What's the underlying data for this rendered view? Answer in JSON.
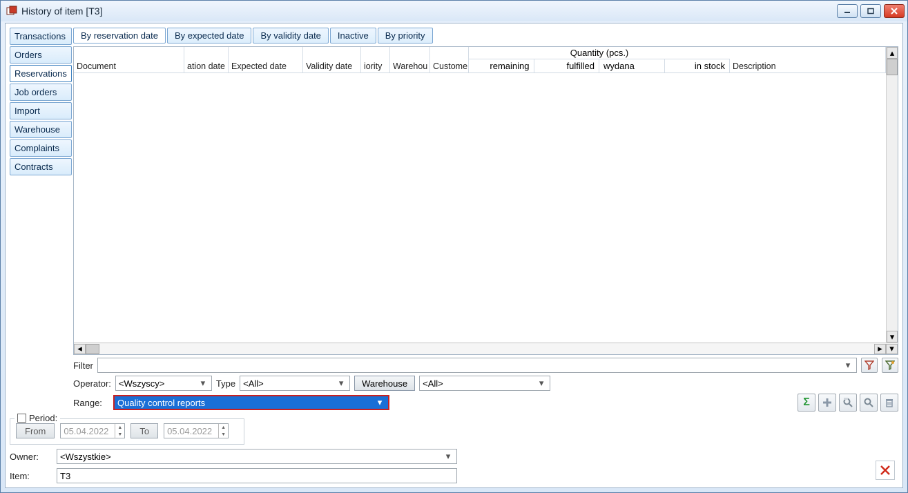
{
  "window": {
    "title": "History of item [T3]"
  },
  "sideTabs": [
    "Transactions",
    "Orders",
    "Reservations",
    "Job orders",
    "Import",
    "Warehouse",
    "Complaints",
    "Contracts"
  ],
  "sideActive": 2,
  "topTabs": [
    "By reservation date",
    "By expected date",
    "By validity date",
    "Inactive",
    "By priority"
  ],
  "topActive": 0,
  "columns": {
    "document": "Document",
    "ation": "ation date",
    "expected": "Expected date",
    "validity": "Validity date",
    "iority": "iority",
    "warehouse": "Warehou",
    "customer": "Custome",
    "qty": "Quantity (pcs.)",
    "description": "Description",
    "remaining": "remaining",
    "fulfilled": "fulfilled",
    "wydana": "wydana",
    "instock": "in stock"
  },
  "filter": {
    "label": "Filter",
    "value": ""
  },
  "operator": {
    "label": "Operator:",
    "value": "<Wszyscy>"
  },
  "type": {
    "label": "Type",
    "value": "<All>"
  },
  "warehouseBtn": "Warehouse",
  "warehouseSel": "<All>",
  "range": {
    "label": "Range:",
    "value": "Quality control reports"
  },
  "period": {
    "label": "Period:",
    "from": "From",
    "to": "To",
    "date1": "05.04.2022",
    "date2": "05.04.2022"
  },
  "owner": {
    "label": "Owner:",
    "value": "<Wszystkie>"
  },
  "item": {
    "label": "Item:",
    "value": "T3"
  }
}
